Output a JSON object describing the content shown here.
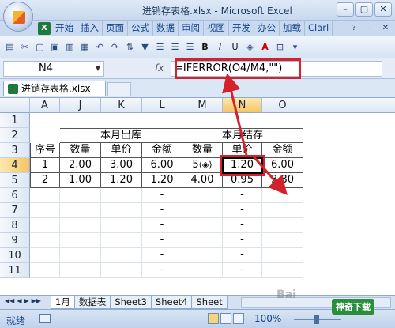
{
  "window": {
    "title": "进销存表格.xlsx - Microsoft Excel",
    "controls": [
      "–",
      "▢",
      "✕"
    ]
  },
  "ribbon": {
    "tabs": [
      "开始",
      "插入",
      "页面",
      "公式",
      "数据",
      "审阅",
      "视图",
      "开发",
      "办公",
      "加载",
      "Clarl"
    ],
    "right_icons": [
      "help-icon",
      "minimize-icon",
      "close-icon"
    ]
  },
  "toolbar": {
    "icons": [
      "paste-icon",
      "cut-icon",
      "new-icon",
      "open-icon",
      "save-icon",
      "print-icon",
      "undo-icon",
      "redo-icon",
      "sort-icon",
      "filter-icon",
      "align-left-icon",
      "align-center-icon",
      "align-right-icon",
      "bold-icon",
      "italic-icon",
      "underline-icon",
      "fill-color-icon",
      "font-color-icon",
      "border-icon",
      "more-icon"
    ],
    "bold_label": "B",
    "italic_label": "I",
    "underline_label": "U",
    "font_color_label": "A"
  },
  "formula_bar": {
    "name_box": "N4",
    "fx_label": "fx",
    "formula": "=IFERROR(O4/M4,\"\")"
  },
  "workbook_tab": {
    "label": "进销存表格.xlsx"
  },
  "grid": {
    "columns": [
      "A",
      "J",
      "K",
      "L",
      "M",
      "N",
      "O"
    ],
    "rows": [
      "1",
      "2",
      "3",
      "4",
      "5",
      "6",
      "7",
      "8",
      "9",
      "10",
      "11"
    ],
    "group_headers": {
      "out": "本月出库",
      "end": "本月结存"
    },
    "headers": {
      "seq": "序号",
      "qty": "数量",
      "price": "单价",
      "amount": "金额"
    },
    "data": [
      [
        "1",
        "2.00",
        "3.00",
        "6.00",
        "5",
        "1.20",
        "6.00"
      ],
      [
        "2",
        "1.00",
        "1.20",
        "1.20",
        "4.00",
        "0.95",
        "3.80"
      ]
    ],
    "dash": "-"
  },
  "sheets": {
    "tabs": [
      "1月",
      "数据表",
      "Sheet3",
      "Sheet4",
      "Sheet"
    ],
    "active": "1月"
  },
  "status": {
    "text": "就绪",
    "zoom": "100%"
  },
  "watermark": {
    "text": "神奇下载"
  },
  "colors": {
    "highlight": "#d2222d",
    "ribbon": "#c9daf0"
  }
}
